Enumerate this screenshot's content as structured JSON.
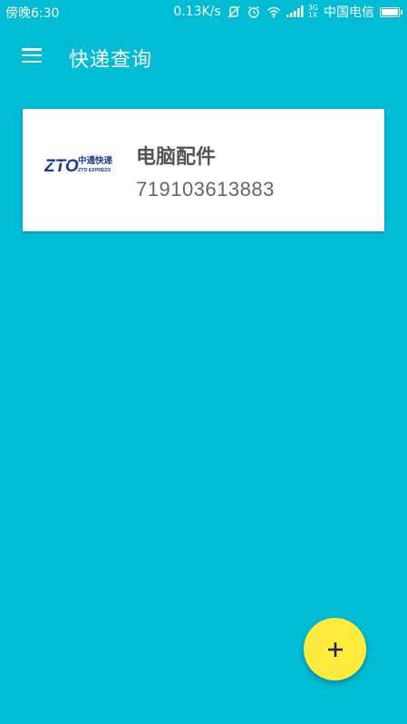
{
  "status_bar": {
    "time": "傍晚6:30",
    "network_speed": "0.13K/s",
    "network_type_top": "3G",
    "network_type_bottom": "1X",
    "carrier": "中国电信",
    "icons": [
      "vibrate-off-icon",
      "alarm-icon",
      "wifi-icon",
      "signal-icon",
      "battery-icon"
    ],
    "battery_level": 1.0
  },
  "app_bar": {
    "title": "快递查询",
    "menu_icon": "hamburger-menu-icon"
  },
  "packages": [
    {
      "courier_logo_text": "中通快递",
      "courier_logo_subtext": "ZTO EXPRESS",
      "courier_logo_mark": "ZTO",
      "name": "电脑配件",
      "tracking_number": "719103613883"
    }
  ],
  "fab": {
    "icon": "plus-icon"
  },
  "colors": {
    "background": "#00BCD4",
    "card": "#FFFFFF",
    "fab": "#FFEB3B",
    "logo_blue": "#1B3A8A"
  }
}
